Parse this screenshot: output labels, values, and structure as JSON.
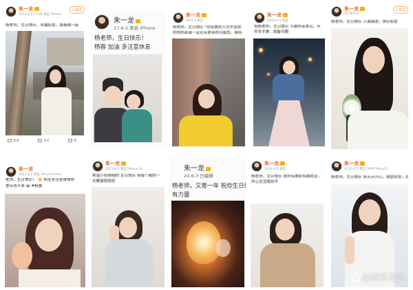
{
  "cards": [
    {
      "username": "朱一龙",
      "meta": "2019-6-3 17:08 来自 iPhone",
      "follow": "+关注",
      "text": "杨老师，生日快乐，幸福如意，事事顺一起",
      "actions": {
        "share": "转发",
        "comment": "评论",
        "like": "赞"
      }
    },
    {
      "username": "朱一龙",
      "date": "17-6-5 来自 iPhone",
      "text_line1": "杨老师，生日快乐！",
      "text_line2": "杨蓉 加油 多注意休息"
    },
    {
      "username": "朱一龙",
      "meta": "18-6-3 来自",
      "text_line1": "杨老师，生日快乐 \"在如果的人生中坚信",
      "text_line2": "的你的表演一定还有更多的可能性，期待"
    },
    {
      "username": "朱一龙",
      "meta": "2019-6-3 来自",
      "text": "祝杨老师，生日快乐 不是所有未完，年年岁岁更...常备可期"
    },
    {
      "username": "朱一龙",
      "badge": "原创",
      "meta": "2019-6-3",
      "text": "杨老师，生日快乐 万事顺遂，快乐如意",
      "follow": "+关注"
    },
    {
      "username": "朱一龙",
      "meta": "2022-6-3 来自 iPhone 8 Plus",
      "text_line1": "老师，生日快乐！ 👏 祝您多注意身体明",
      "text_line2": "里存货不多 😄 #杨蓉"
    },
    {
      "username": "朱一龙",
      "meta": "2023-6-3 来自 iPhone 6s",
      "text": "希望少些稍稍的 生日快乐 祝每个都的一天都是轻轻好"
    },
    {
      "username": "朱一龙",
      "date": "20-6-3 已编辑",
      "text_line1": "杨老师，又是一年 祝你生日快乐",
      "text_line2": "有力量"
    },
    {
      "username": "朱一龙",
      "meta": "2024-6-3 来自",
      "text": "杨老师，生日快乐 愿所有美好如期而至，开心生活每份手"
    },
    {
      "username": "朱一龙",
      "meta": "2025-6-3 来自 OPPO Reno12",
      "text": "杨老师，生日快乐 祝天天开心，顺意如意，自在自在"
    }
  ],
  "watermark": "@娱乐潮头",
  "icons": {
    "avatar": "avatar",
    "crown": "crown-badge",
    "watermark": "weibo-logo-icon"
  }
}
